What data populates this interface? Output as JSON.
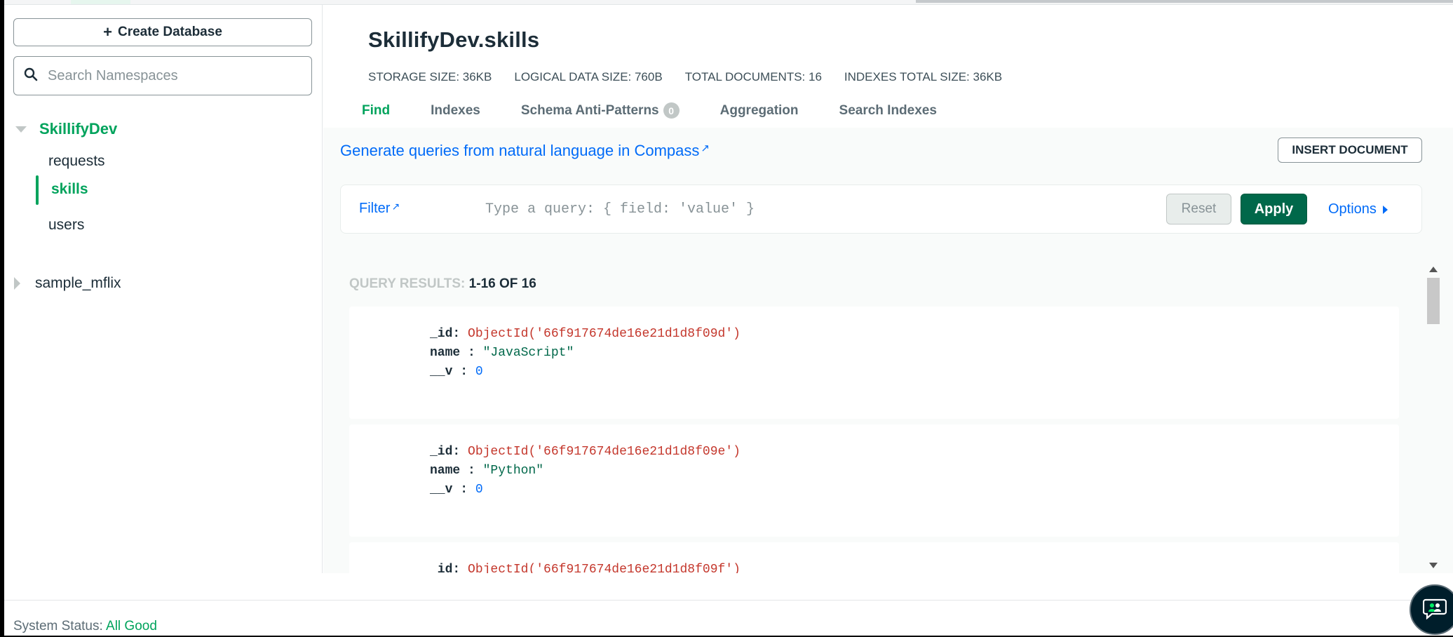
{
  "sidebar": {
    "create_database": "Create Database",
    "search_placeholder": "Search Namespaces",
    "databases": [
      {
        "name": "SkillifyDev",
        "collections": [
          "requests",
          "skills",
          "users"
        ]
      },
      {
        "name": "sample_mflix"
      }
    ],
    "active_collection": "skills"
  },
  "header": {
    "namespace": "SkillifyDev.skills",
    "stats": {
      "storage": "STORAGE SIZE: 36KB",
      "logical": "LOGICAL DATA SIZE: 760B",
      "documents": "TOTAL DOCUMENTS: 16",
      "indexes": "INDEXES TOTAL SIZE: 36KB"
    },
    "tabs": {
      "find": "Find",
      "indexes": "Indexes",
      "schema": "Schema Anti-Patterns",
      "schema_badge": "0",
      "aggregation": "Aggregation",
      "search_indexes": "Search Indexes"
    }
  },
  "query": {
    "nl_link": "Generate queries from natural language in Compass",
    "insert_document": "INSERT DOCUMENT",
    "filter_label": "Filter",
    "placeholder": "Type a query: { field: 'value' }",
    "reset": "Reset",
    "apply": "Apply",
    "options": "Options"
  },
  "results": {
    "label": "QUERY RESULTS:",
    "count": "1-16 OF 16",
    "documents": [
      {
        "id_key": "_id:",
        "id": "ObjectId('66f917674de16e21d1d8f09d')",
        "name_key": "name :",
        "name": "\"JavaScript\"",
        "v_key": "__v :",
        "v": "0"
      },
      {
        "id_key": "_id:",
        "id": "ObjectId('66f917674de16e21d1d8f09e')",
        "name_key": "name :",
        "name": "\"Python\"",
        "v_key": "__v :",
        "v": "0"
      },
      {
        "id_key": "_id:",
        "id": "ObjectId('66f917674de16e21d1d8f09f')",
        "name_key": "",
        "name": "",
        "v_key": "",
        "v": ""
      }
    ]
  },
  "footer": {
    "status_label": "System Status:",
    "status_value": "All Good"
  },
  "colors": {
    "accent_green": "#00a35c",
    "apply_green": "#00684a",
    "link_blue": "#016bf8",
    "oid_red": "#c4372c"
  }
}
